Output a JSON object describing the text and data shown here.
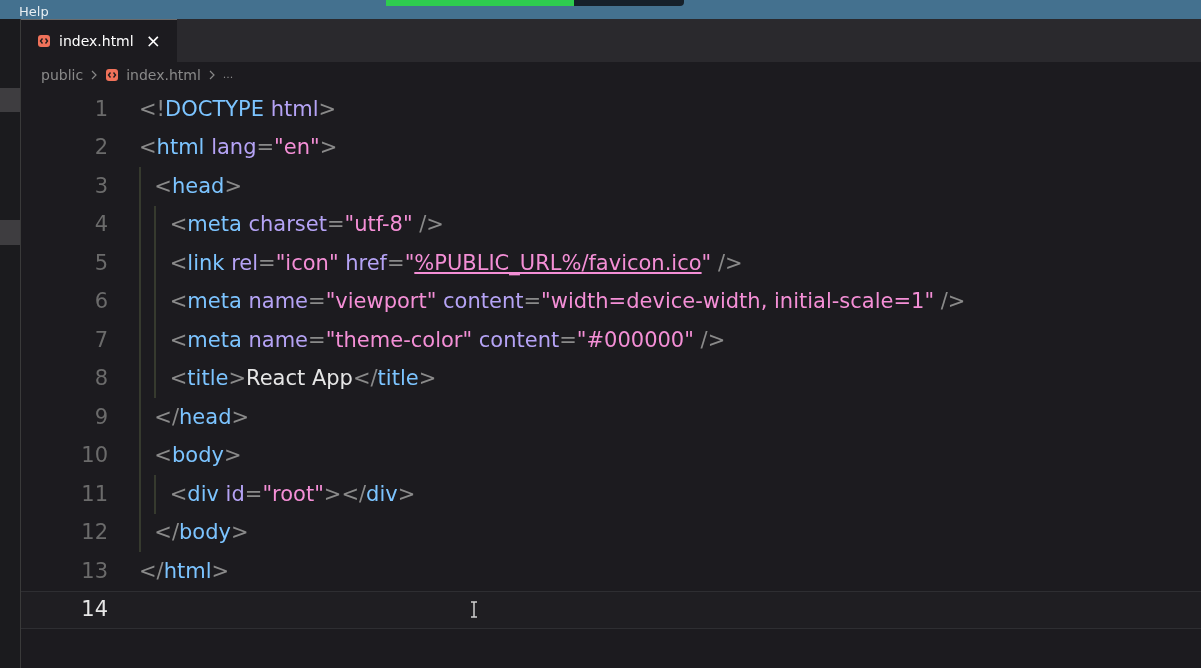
{
  "menu": {
    "items": [
      {
        "label": "Help"
      }
    ]
  },
  "tabs": [
    {
      "label": "index.html",
      "selected": true,
      "close": "×"
    }
  ],
  "breadcrumb": [
    "public",
    "index.html",
    "..."
  ],
  "editor": {
    "lines": [
      {
        "number": "1",
        "selected": false,
        "tokens": [
          {
            "kind": "punct",
            "text": "<!"
          },
          {
            "kind": "tag",
            "text": "DOCTYPE"
          },
          {
            "kind": "attr",
            "text": " html"
          },
          {
            "kind": "punct",
            "text": ">"
          }
        ]
      },
      {
        "number": "2",
        "selected": false,
        "tokens": [
          {
            "kind": "punct",
            "text": "<"
          },
          {
            "kind": "tag",
            "text": "html"
          },
          {
            "kind": "attr",
            "text": " lang"
          },
          {
            "kind": "punct",
            "text": "="
          },
          {
            "kind": "str",
            "text": "\"en\""
          },
          {
            "kind": "punct",
            "text": ">"
          }
        ]
      },
      {
        "number": "3",
        "selected": false,
        "tokens": [
          {
            "kind": "punct",
            "text": "  <"
          },
          {
            "kind": "tag",
            "text": "head"
          },
          {
            "kind": "punct",
            "text": ">"
          }
        ]
      },
      {
        "number": "4",
        "selected": false,
        "tokens": [
          {
            "kind": "punct",
            "text": "    <"
          },
          {
            "kind": "tag",
            "text": "meta"
          },
          {
            "kind": "attr",
            "text": " charset"
          },
          {
            "kind": "punct",
            "text": "="
          },
          {
            "kind": "str",
            "text": "\"utf-8\""
          },
          {
            "kind": "punct",
            "text": " />"
          }
        ]
      },
      {
        "number": "5",
        "selected": false,
        "tokens": [
          {
            "kind": "punct",
            "text": "    <"
          },
          {
            "kind": "tag",
            "text": "link"
          },
          {
            "kind": "attr",
            "text": " rel"
          },
          {
            "kind": "punct",
            "text": "="
          },
          {
            "kind": "str",
            "text": "\"icon\""
          },
          {
            "kind": "attr",
            "text": " href"
          },
          {
            "kind": "punct",
            "text": "="
          },
          {
            "kind": "str",
            "text": "\""
          },
          {
            "kind": "link",
            "text": "%PUBLIC_URL%/favicon.ico"
          },
          {
            "kind": "str",
            "text": "\""
          },
          {
            "kind": "punct",
            "text": " />"
          }
        ]
      },
      {
        "number": "6",
        "selected": false,
        "tokens": [
          {
            "kind": "punct",
            "text": "    <"
          },
          {
            "kind": "tag",
            "text": "meta"
          },
          {
            "kind": "attr",
            "text": " name"
          },
          {
            "kind": "punct",
            "text": "="
          },
          {
            "kind": "str",
            "text": "\"viewport\""
          },
          {
            "kind": "attr",
            "text": " content"
          },
          {
            "kind": "punct",
            "text": "="
          },
          {
            "kind": "str",
            "text": "\"width=device-width, initial-scale=1\""
          },
          {
            "kind": "punct",
            "text": " />"
          }
        ]
      },
      {
        "number": "7",
        "selected": false,
        "tokens": [
          {
            "kind": "punct",
            "text": "    <"
          },
          {
            "kind": "tag",
            "text": "meta"
          },
          {
            "kind": "attr",
            "text": " name"
          },
          {
            "kind": "punct",
            "text": "="
          },
          {
            "kind": "str",
            "text": "\"theme-color\""
          },
          {
            "kind": "attr",
            "text": " content"
          },
          {
            "kind": "punct",
            "text": "="
          },
          {
            "kind": "str",
            "text": "\"#000000\""
          },
          {
            "kind": "punct",
            "text": " />"
          }
        ]
      },
      {
        "number": "8",
        "selected": false,
        "tokens": [
          {
            "kind": "punct",
            "text": "    <"
          },
          {
            "kind": "tag",
            "text": "title"
          },
          {
            "kind": "punct",
            "text": ">"
          },
          {
            "kind": "text",
            "text": "React App"
          },
          {
            "kind": "punct",
            "text": "</"
          },
          {
            "kind": "tag",
            "text": "title"
          },
          {
            "kind": "punct",
            "text": ">"
          }
        ]
      },
      {
        "number": "9",
        "selected": false,
        "tokens": [
          {
            "kind": "punct",
            "text": "  </"
          },
          {
            "kind": "tag",
            "text": "head"
          },
          {
            "kind": "punct",
            "text": ">"
          }
        ]
      },
      {
        "number": "10",
        "selected": false,
        "tokens": [
          {
            "kind": "punct",
            "text": "  <"
          },
          {
            "kind": "tag",
            "text": "body"
          },
          {
            "kind": "punct",
            "text": ">"
          }
        ]
      },
      {
        "number": "11",
        "selected": false,
        "tokens": [
          {
            "kind": "punct",
            "text": "    <"
          },
          {
            "kind": "tag",
            "text": "div"
          },
          {
            "kind": "attr",
            "text": " id"
          },
          {
            "kind": "punct",
            "text": "="
          },
          {
            "kind": "str",
            "text": "\"root\""
          },
          {
            "kind": "punct",
            "text": "></"
          },
          {
            "kind": "tag",
            "text": "div"
          },
          {
            "kind": "punct",
            "text": ">"
          }
        ]
      },
      {
        "number": "12",
        "selected": false,
        "tokens": [
          {
            "kind": "punct",
            "text": "  </"
          },
          {
            "kind": "tag",
            "text": "body"
          },
          {
            "kind": "punct",
            "text": ">"
          }
        ]
      },
      {
        "number": "13",
        "selected": false,
        "tokens": [
          {
            "kind": "punct",
            "text": "</"
          },
          {
            "kind": "tag",
            "text": "html"
          },
          {
            "kind": "punct",
            "text": ">"
          }
        ]
      },
      {
        "number": "14",
        "selected": true
      }
    ]
  }
}
